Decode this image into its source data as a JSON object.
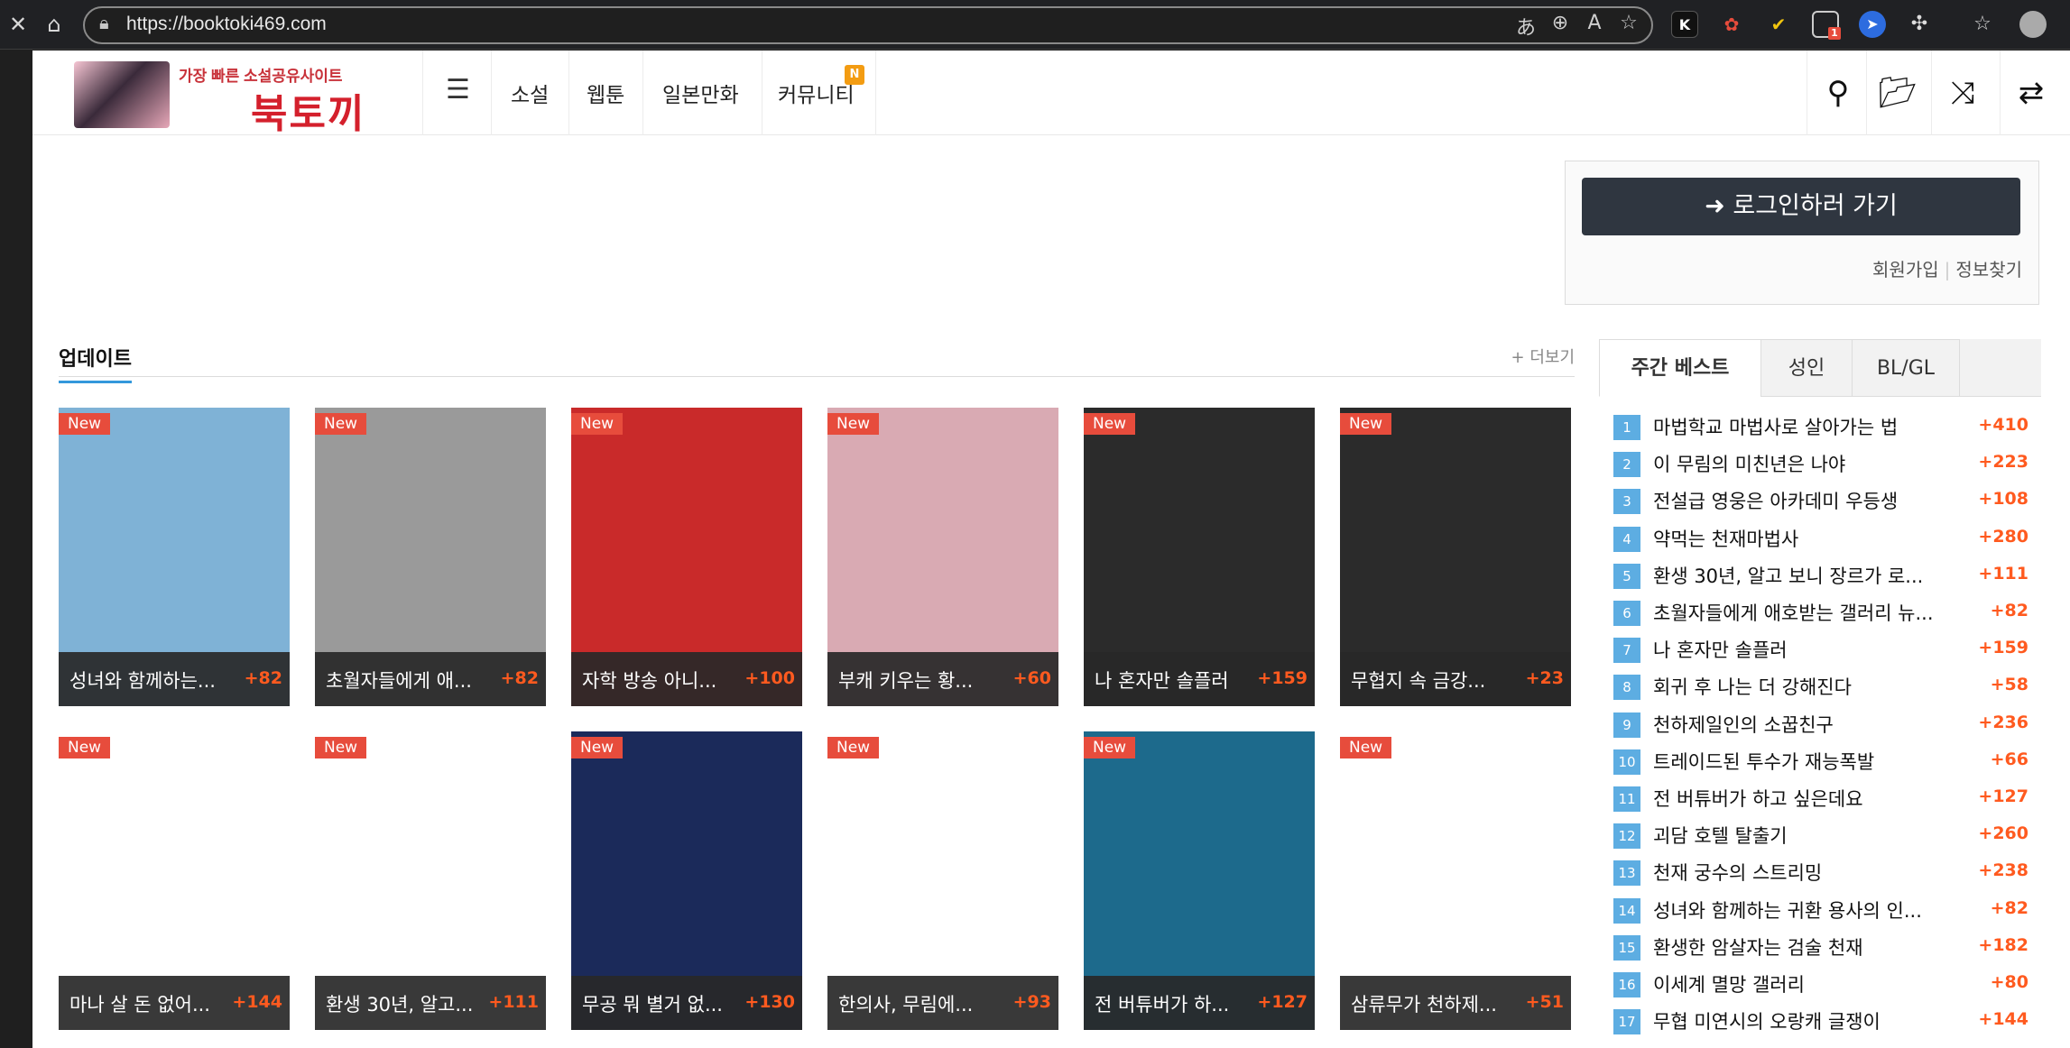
{
  "browser": {
    "url": "https://booktoki469.com",
    "ext_k": "K",
    "ext_badge": "1"
  },
  "site": {
    "logo_tagline": "가장 빠른 소설공유사이트",
    "logo_name": "북토끼",
    "nav": [
      "소설",
      "웹툰",
      "일본만화",
      "커뮤니티"
    ],
    "nav_badge": "N"
  },
  "login": {
    "button": "로그인하러 가기",
    "signup": "회원가입",
    "find_info": "정보찾기"
  },
  "updates": {
    "title": "업데이트",
    "more": "+ 더보기",
    "new_label": "New",
    "cards": [
      {
        "title": "성녀와 함께하는...",
        "count": "+82",
        "color": "#7fb2d6"
      },
      {
        "title": "초월자들에게 애...",
        "count": "+82",
        "color": "#9a9a9a"
      },
      {
        "title": "자학 방송 아니...",
        "count": "+100",
        "color": "#c92a2a"
      },
      {
        "title": "부캐 키우는 황...",
        "count": "+60",
        "color": "#d9aab3"
      },
      {
        "title": "나 혼자만 솔플러",
        "count": "+159",
        "color": "#2b2b2b"
      },
      {
        "title": "무협지 속 금강...",
        "count": "+23",
        "color": "#2b2b2b"
      },
      {
        "title": "마나 살 돈 없어...",
        "count": "+144",
        "color": "#ffffff"
      },
      {
        "title": "환생 30년, 알고...",
        "count": "+111",
        "color": "#ffffff"
      },
      {
        "title": "무공 뭐 별거 없...",
        "count": "+130",
        "color": "#1b2a5a"
      },
      {
        "title": "한의사, 무림에...",
        "count": "+93",
        "color": "#ffffff"
      },
      {
        "title": "전 버튜버가 하...",
        "count": "+127",
        "color": "#1d6a8c"
      },
      {
        "title": "삼류무가 천하제...",
        "count": "+51",
        "color": "#ffffff"
      }
    ]
  },
  "weekly": {
    "tabs": [
      "주간 베스트",
      "성인",
      "BL/GL"
    ],
    "items": [
      {
        "rank": "1",
        "title": "마법학교 마법사로 살아가는 법",
        "count": "+410"
      },
      {
        "rank": "2",
        "title": "이 무림의 미친년은 나야",
        "count": "+223"
      },
      {
        "rank": "3",
        "title": "전설급 영웅은 아카데미 우등생",
        "count": "+108"
      },
      {
        "rank": "4",
        "title": "약먹는 천재마법사",
        "count": "+280"
      },
      {
        "rank": "5",
        "title": "환생 30년, 알고 보니 장르가 로...",
        "count": "+111"
      },
      {
        "rank": "6",
        "title": "초월자들에게 애호받는 갤러리 뉴...",
        "count": "+82"
      },
      {
        "rank": "7",
        "title": "나 혼자만 솔플러",
        "count": "+159"
      },
      {
        "rank": "8",
        "title": "회귀 후 나는 더 강해진다",
        "count": "+58"
      },
      {
        "rank": "9",
        "title": "천하제일인의 소꿉친구",
        "count": "+236"
      },
      {
        "rank": "10",
        "title": "트레이드된 투수가 재능폭발",
        "count": "+66"
      },
      {
        "rank": "11",
        "title": "전 버튜버가 하고 싶은데요",
        "count": "+127"
      },
      {
        "rank": "12",
        "title": "괴담 호텔 탈출기",
        "count": "+260"
      },
      {
        "rank": "13",
        "title": "천재 궁수의 스트리밍",
        "count": "+238"
      },
      {
        "rank": "14",
        "title": "성녀와 함께하는 귀환 용사의 인...",
        "count": "+82"
      },
      {
        "rank": "15",
        "title": "환생한 암살자는 검술 천재",
        "count": "+182"
      },
      {
        "rank": "16",
        "title": "이세계 멸망 갤러리",
        "count": "+80"
      },
      {
        "rank": "17",
        "title": "무협 미연시의 오랑캐 글쟁이",
        "count": "+144"
      }
    ]
  }
}
